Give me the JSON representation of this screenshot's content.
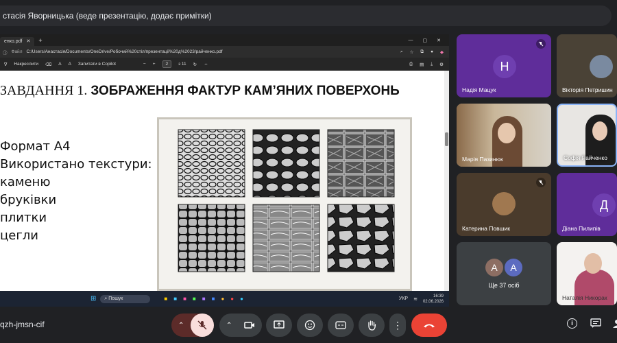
{
  "topbar": {
    "presenter_text": "стасія Яворницька (веде презентацію, додає примітки)"
  },
  "browser": {
    "tab_title": "енко.pdf",
    "address_prefix": "Файл",
    "address": "C:/Users/Анастасія/Documents/OneDrive/Робочий%20стіл/презентації%20д%2023/райченко.pdf",
    "toolbar": {
      "draw": "Накреслити",
      "ask_copilot": "Запитати в Copilot",
      "page_current": "2",
      "page_total": "з 11",
      "text_size": "A",
      "read": "A"
    }
  },
  "slide": {
    "title_prefix": "ЗАВДАННЯ 1. ",
    "title_bold": "ЗОБРАЖЕННЯ ФАКТУР КАМ’ЯНИХ ПОВЕРХОНЬ",
    "bullets": [
      "Формат А4",
      "Використано текстури:",
      "каменю",
      "бруківки",
      "плитки",
      "цегли"
    ]
  },
  "taskbar": {
    "search": "Пошук",
    "lang": "УКР",
    "time": "16:39",
    "date": "02.06.2026"
  },
  "participants": [
    {
      "name": "Надія Мацук",
      "initial": "Н",
      "bg": "#5f2d9a",
      "avatar_bg": "#6f3fb0",
      "muted": true
    },
    {
      "name": "Вікторія Петришин",
      "bg": "#4a4236",
      "muted": false
    },
    {
      "name": "Марія Пазинюк",
      "muted": false
    },
    {
      "name": "Софія Райченко",
      "muted": false
    },
    {
      "name": "Катерина Повшик",
      "muted": true
    },
    {
      "name": "Діана Пилипів",
      "initial": "Д",
      "bg": "#5f2d9a",
      "muted": false
    },
    {
      "name": "Ще 37 осіб",
      "others": [
        "А",
        "А"
      ]
    },
    {
      "name": "Наталія Никорак",
      "muted": false
    }
  ],
  "meeting": {
    "code": "qzh-jmsn-cif"
  },
  "colors": {
    "accent_purple": "#6f3fb0",
    "end_call": "#ea4335",
    "mic_off": "#f28b82"
  }
}
